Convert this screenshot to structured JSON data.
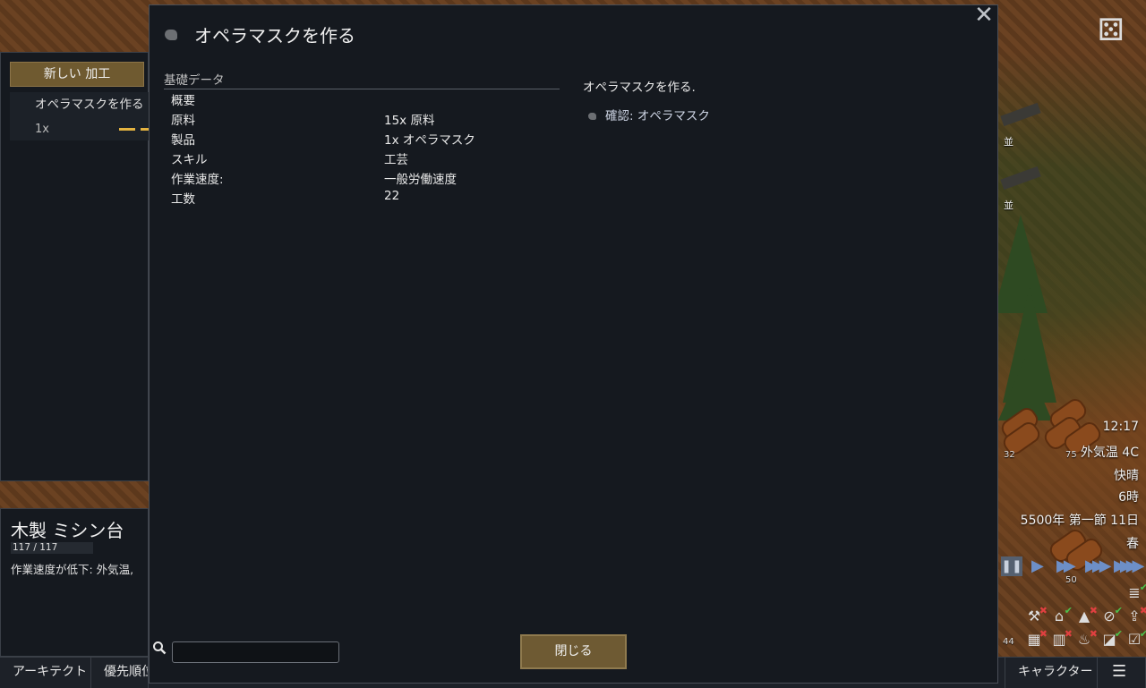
{
  "dialog": {
    "title": "オペラマスクを作る",
    "section_header": "基礎データ",
    "stats": [
      {
        "label": "概要",
        "value": ""
      },
      {
        "label": "原料",
        "value": "15x 原料"
      },
      {
        "label": "製品",
        "value": "1x オペラマスク"
      },
      {
        "label": "スキル",
        "value": "工芸"
      },
      {
        "label": "作業速度:",
        "value": "一般労働速度"
      },
      {
        "label": "工数",
        "value": "22"
      }
    ],
    "description": "オペラマスクを作る.",
    "confirm_label": "確認: オペラマスク",
    "search_placeholder": "",
    "close_button_label": "閉じる"
  },
  "bill_panel": {
    "new_bill_label": "新しい 加工",
    "bill_name": "オペラマスクを作る",
    "bill_count": "1x"
  },
  "inspect": {
    "title": "木製 ミシン台",
    "hp": "117 / 117",
    "note": "作業速度が低下: 外気温,"
  },
  "bottom_bar": {
    "tabs": [
      "アーキテクト",
      "優先順位"
    ],
    "right_tab": "キャラクター"
  },
  "hud": {
    "time": "12:17",
    "outdoor_temp": "外気温 4C",
    "weather": "快晴",
    "hour": "6時",
    "date": "5500年 第一節 11日",
    "season": "春",
    "weapon_labels": [
      "並",
      "並"
    ],
    "stack_counts": [
      "32",
      "75",
      "50",
      "44"
    ]
  },
  "colors": {
    "dialog_bg": "#15191f",
    "button_bg": "#6e5a33",
    "speed_blue": "#6d8fc7",
    "toggle_on": "#4cc24c",
    "toggle_off": "#e04040"
  },
  "icons": {
    "dialog": "mask-icon",
    "close": "close-icon",
    "search": "search-icon",
    "dice": "dice-icon",
    "menu": "menu-icon"
  }
}
